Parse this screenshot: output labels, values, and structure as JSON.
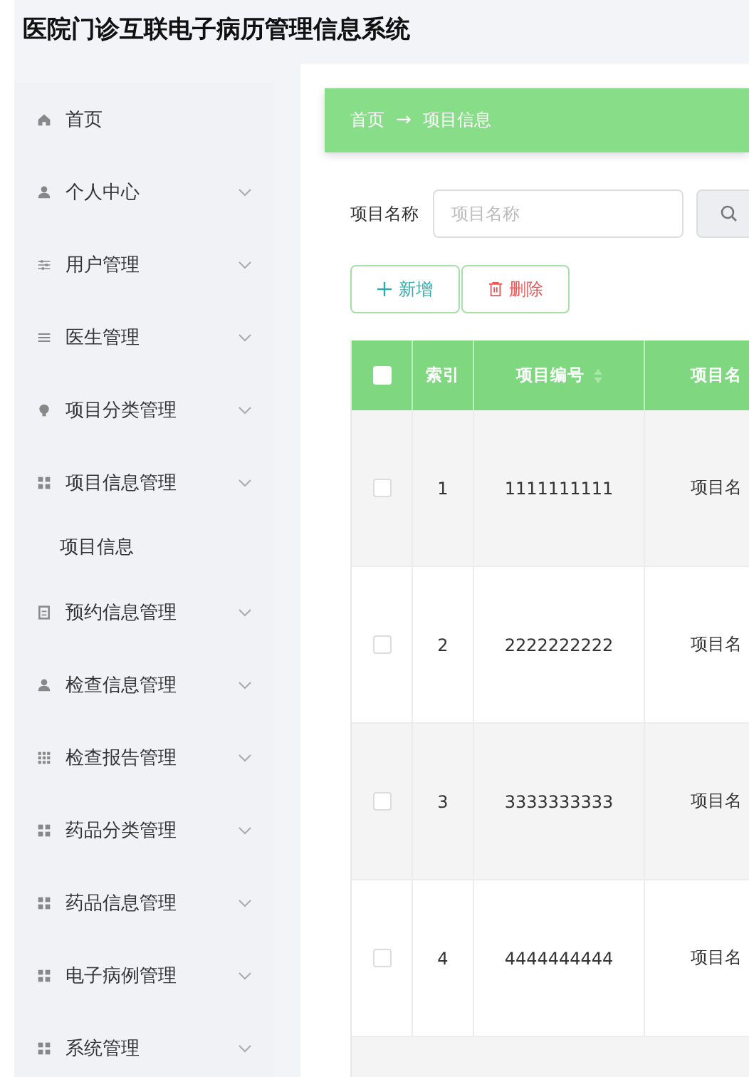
{
  "window": {
    "title": "医院门诊互联电子病历管理信息系统"
  },
  "sidebar": {
    "items": [
      {
        "label": "首页",
        "kind": "link"
      },
      {
        "label": "个人中心",
        "kind": "submenu"
      },
      {
        "label": "用户管理",
        "kind": "submenu"
      },
      {
        "label": "医生管理",
        "kind": "submenu"
      },
      {
        "label": "项目分类管理",
        "kind": "submenu"
      },
      {
        "label": "项目信息管理",
        "kind": "submenu",
        "children": [
          {
            "label": "项目信息"
          }
        ]
      },
      {
        "label": "预约信息管理",
        "kind": "submenu"
      },
      {
        "label": "检查信息管理",
        "kind": "submenu"
      },
      {
        "label": "检查报告管理",
        "kind": "submenu"
      },
      {
        "label": "药品分类管理",
        "kind": "submenu"
      },
      {
        "label": "药品信息管理",
        "kind": "submenu"
      },
      {
        "label": "电子病例管理",
        "kind": "submenu"
      },
      {
        "label": "系统管理",
        "kind": "submenu"
      }
    ]
  },
  "breadcrumb": {
    "items": [
      "首页",
      "项目信息"
    ],
    "separator": "→"
  },
  "search": {
    "label": "项目名称",
    "placeholder": "项目名称"
  },
  "buttons": [
    {
      "label": "新增",
      "kind": "add"
    },
    {
      "label": "删除",
      "kind": "delete"
    }
  ],
  "table": {
    "select_all_checked": false,
    "columns": [
      "索引",
      "项目编号",
      "项目名"
    ],
    "rows": [
      {
        "checked": false,
        "cells": [
          "1",
          "1111111111",
          "项目名"
        ]
      },
      {
        "checked": false,
        "cells": [
          "2",
          "2222222222",
          "项目名"
        ]
      },
      {
        "checked": false,
        "cells": [
          "3",
          "3333333333",
          "项目名"
        ]
      },
      {
        "checked": false,
        "cells": [
          "4",
          "4444444444",
          "项目名"
        ]
      }
    ]
  }
}
